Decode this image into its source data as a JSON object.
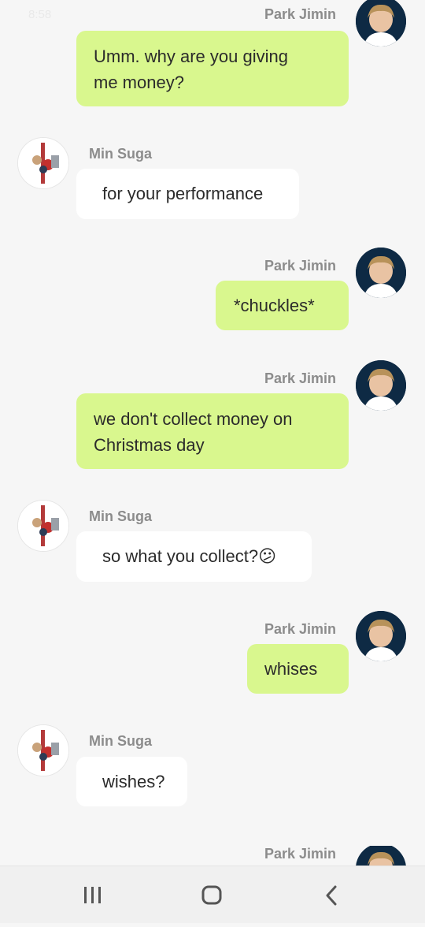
{
  "status_bar": {
    "time": "8:58"
  },
  "messages": [
    {
      "sender": "Park Jimin",
      "side": "out",
      "text_lines": [
        "Umm. why are you giving",
        "me money?"
      ]
    },
    {
      "sender": "Min Suga",
      "side": "in",
      "text_lines": [
        "for your performance"
      ]
    },
    {
      "sender": "Park Jimin",
      "side": "out",
      "text_lines": [
        "*chuckles*"
      ]
    },
    {
      "sender": "Park Jimin",
      "side": "out",
      "text_lines": [
        "we don't collect money on",
        "Christmas day"
      ]
    },
    {
      "sender": "Min Suga",
      "side": "in",
      "text_lines": [
        "so what you collect?😕"
      ]
    },
    {
      "sender": "Park Jimin",
      "side": "out",
      "text_lines": [
        "whises"
      ]
    },
    {
      "sender": "Min Suga",
      "side": "in",
      "text_lines": [
        "wishes?"
      ]
    },
    {
      "sender": "Park Jimin",
      "side": "out",
      "text_lines": []
    }
  ],
  "nav_bar": {
    "icons": [
      "recent-apps-icon",
      "home-icon",
      "back-icon"
    ]
  }
}
